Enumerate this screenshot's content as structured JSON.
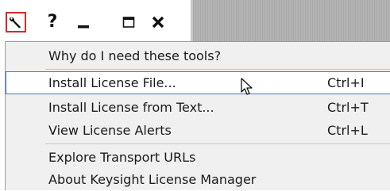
{
  "toolbar": {
    "buttons": [
      {
        "name": "tools",
        "icon": "wrench-icon"
      },
      {
        "name": "help",
        "label": "?",
        "icon": "help-icon"
      },
      {
        "name": "minimize",
        "icon": "minimize-icon"
      },
      {
        "name": "maximize",
        "icon": "maximize-icon"
      },
      {
        "name": "close",
        "icon": "close-icon"
      }
    ],
    "help_label": "?",
    "active_border_color": "#d42a2a"
  },
  "menu": {
    "hover_border_color": "#2f7bd6",
    "items": [
      {
        "label": "Why do I need these tools?",
        "shortcut": ""
      },
      {
        "label": "Install License File...",
        "shortcut": "Ctrl+I",
        "hovered": true
      },
      {
        "label": "Install License from Text...",
        "shortcut": "Ctrl+T"
      },
      {
        "label": "View License Alerts",
        "shortcut": "Ctrl+L"
      },
      {
        "label": "Explore Transport URLs",
        "shortcut": ""
      },
      {
        "label": "About Keysight License Manager",
        "shortcut": ""
      }
    ]
  },
  "cursor": {
    "icon": "mouse-pointer-icon"
  }
}
